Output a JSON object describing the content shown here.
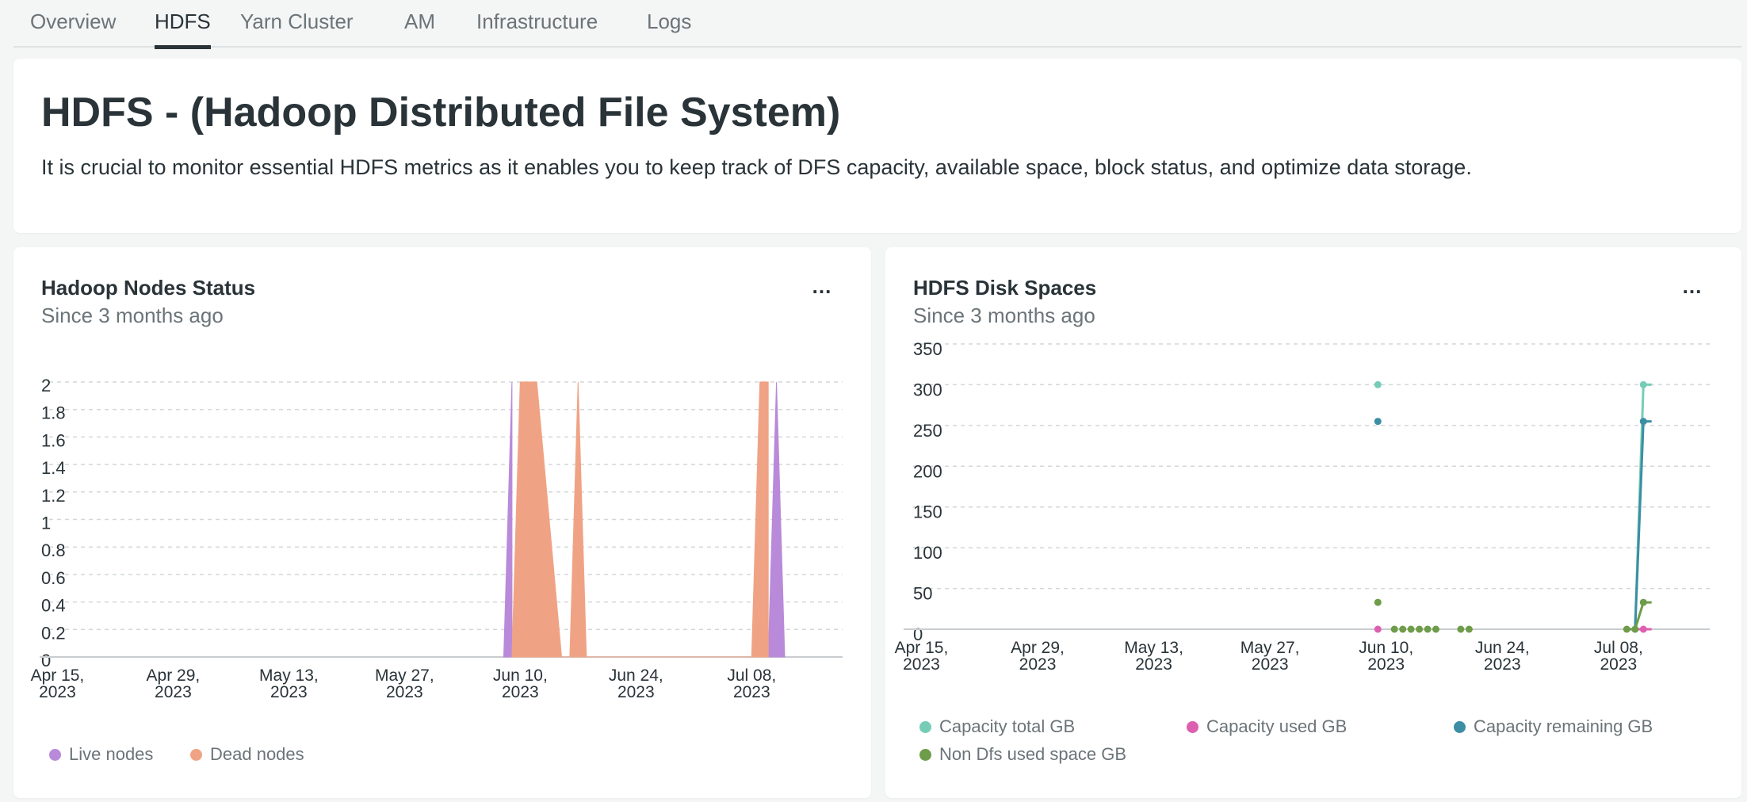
{
  "tabs": [
    {
      "label": "Overview",
      "active": false
    },
    {
      "label": "HDFS",
      "active": true
    },
    {
      "label": "Yarn Cluster",
      "active": false
    },
    {
      "label": "AM",
      "active": false
    },
    {
      "label": "Infrastructure",
      "active": false
    },
    {
      "label": "Logs",
      "active": false
    }
  ],
  "intro": {
    "title": "HDFS - (Hadoop Distributed File System)",
    "description": "It is crucial to monitor essential HDFS metrics as it enables you to keep track of DFS capacity, available space, block status, and optimize data storage."
  },
  "panels": {
    "nodes": {
      "title": "Hadoop Nodes Status",
      "subtitle": "Since 3 months ago",
      "menu": "..."
    },
    "disk": {
      "title": "HDFS Disk Spaces",
      "subtitle": "Since 3 months ago",
      "menu": "..."
    }
  },
  "colors": {
    "live_nodes": "#b98ad9",
    "dead_nodes": "#f0a384",
    "capacity_total": "#76cdb7",
    "capacity_used": "#de5fb0",
    "capacity_remaining": "#3c8ea4",
    "non_dfs_used": "#6e9c48"
  },
  "chart_data": [
    {
      "type": "area",
      "title": "Hadoop Nodes Status",
      "subtitle": "Since 3 months ago",
      "y_ticks": [
        "2",
        "1.8",
        "1.6",
        "1.4",
        "1.2",
        "1",
        "0.8",
        "0.6",
        "0.4",
        "0.2",
        "0"
      ],
      "ylim": [
        0,
        2
      ],
      "x_ticks": [
        {
          "date": "2023-04-15",
          "line1": "Apr 15,",
          "line2": "2023"
        },
        {
          "date": "2023-04-29",
          "line1": "Apr 29,",
          "line2": "2023"
        },
        {
          "date": "2023-05-13",
          "line1": "May 13,",
          "line2": "2023"
        },
        {
          "date": "2023-05-27",
          "line1": "May 27,",
          "line2": "2023"
        },
        {
          "date": "2023-06-10",
          "line1": "Jun 10,",
          "line2": "2023"
        },
        {
          "date": "2023-06-24",
          "line1": "Jun 24,",
          "line2": "2023"
        },
        {
          "date": "2023-07-08",
          "line1": "Jul 08,",
          "line2": "2023"
        }
      ],
      "xlim": [
        "2023-04-14",
        "2023-07-19"
      ],
      "grid": true,
      "legend_position": "bottom-left",
      "series": [
        {
          "name": "Live nodes",
          "color_key": "live_nodes",
          "points": [
            [
              "2023-06-08",
              0
            ],
            [
              "2023-06-08",
              0
            ],
            [
              "2023-06-09",
              2
            ],
            [
              "2023-06-09",
              0
            ],
            [
              "2023-07-10",
              0
            ],
            [
              "2023-07-11",
              2
            ],
            [
              "2023-07-11",
              2
            ],
            [
              "2023-07-12",
              0
            ]
          ]
        },
        {
          "name": "Dead nodes",
          "color_key": "dead_nodes",
          "points": [
            [
              "2023-06-09",
              0
            ],
            [
              "2023-06-10",
              2
            ],
            [
              "2023-06-12",
              2
            ],
            [
              "2023-06-15",
              0
            ],
            [
              "2023-06-16",
              0
            ],
            [
              "2023-06-17",
              2
            ],
            [
              "2023-06-17",
              2
            ],
            [
              "2023-06-18",
              0
            ],
            [
              "2023-07-08",
              0
            ],
            [
              "2023-07-09",
              2
            ],
            [
              "2023-07-10",
              2
            ],
            [
              "2023-07-10",
              0
            ]
          ]
        }
      ]
    },
    {
      "type": "line",
      "title": "HDFS Disk Spaces",
      "subtitle": "Since 3 months ago",
      "y_ticks": [
        "350",
        "300",
        "250",
        "200",
        "150",
        "100",
        "50",
        "0"
      ],
      "ylim": [
        0,
        350
      ],
      "x_ticks": [
        {
          "date": "2023-04-15",
          "line1": "Apr 15,",
          "line2": "2023"
        },
        {
          "date": "2023-04-29",
          "line1": "Apr 29,",
          "line2": "2023"
        },
        {
          "date": "2023-05-13",
          "line1": "May 13,",
          "line2": "2023"
        },
        {
          "date": "2023-05-27",
          "line1": "May 27,",
          "line2": "2023"
        },
        {
          "date": "2023-06-10",
          "line1": "Jun 10,",
          "line2": "2023"
        },
        {
          "date": "2023-06-24",
          "line1": "Jun 24,",
          "line2": "2023"
        },
        {
          "date": "2023-07-08",
          "line1": "Jul 08,",
          "line2": "2023"
        }
      ],
      "xlim": [
        "2023-04-14",
        "2023-07-19"
      ],
      "grid": true,
      "legend_position": "bottom",
      "series": [
        {
          "name": "Capacity total GB",
          "color_key": "capacity_total",
          "line": [
            [
              "2023-07-10",
              0
            ],
            [
              "2023-07-11",
              300
            ],
            [
              "2023-07-12",
              300
            ]
          ],
          "points": [
            [
              "2023-06-09",
              300
            ],
            [
              "2023-07-10",
              0
            ],
            [
              "2023-07-11",
              300
            ]
          ]
        },
        {
          "name": "Capacity used GB",
          "color_key": "capacity_used",
          "line": [
            [
              "2023-07-10",
              0
            ],
            [
              "2023-07-11",
              0
            ],
            [
              "2023-07-12",
              0
            ]
          ],
          "points": [
            [
              "2023-06-09",
              0
            ],
            [
              "2023-07-11",
              0
            ]
          ]
        },
        {
          "name": "Capacity remaining GB",
          "color_key": "capacity_remaining",
          "line": [
            [
              "2023-07-10",
              0
            ],
            [
              "2023-07-11",
              255
            ],
            [
              "2023-07-12",
              255
            ]
          ],
          "points": [
            [
              "2023-06-09",
              255
            ],
            [
              "2023-07-11",
              255
            ]
          ]
        },
        {
          "name": "Non Dfs used space GB",
          "color_key": "non_dfs_used",
          "line": [
            [
              "2023-07-09",
              0
            ],
            [
              "2023-07-10",
              0
            ],
            [
              "2023-07-11",
              33
            ],
            [
              "2023-07-12",
              33
            ]
          ],
          "points": [
            [
              "2023-06-09",
              33
            ],
            [
              "2023-06-11",
              0
            ],
            [
              "2023-06-12",
              0
            ],
            [
              "2023-06-13",
              0
            ],
            [
              "2023-06-14",
              0
            ],
            [
              "2023-06-15",
              0
            ],
            [
              "2023-06-16",
              0
            ],
            [
              "2023-06-19",
              0
            ],
            [
              "2023-06-20",
              0
            ],
            [
              "2023-07-09",
              0
            ],
            [
              "2023-07-10",
              0
            ],
            [
              "2023-07-11",
              33
            ]
          ]
        }
      ]
    }
  ]
}
